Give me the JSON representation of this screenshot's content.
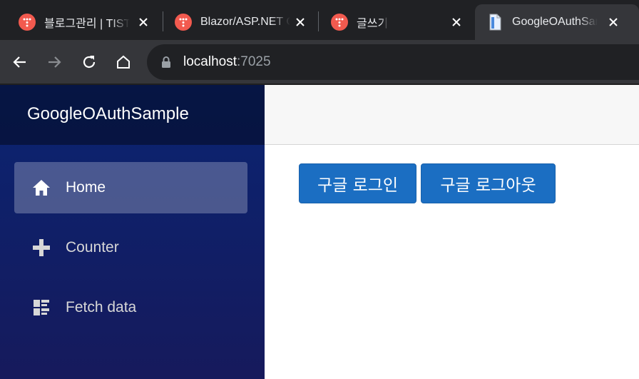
{
  "browser": {
    "tabs": [
      {
        "title": "블로그관리 | TISTORY",
        "favicon": "tistory-icon",
        "active": false
      },
      {
        "title": "Blazor/ASP.NET Core",
        "favicon": "tistory-icon",
        "active": false
      },
      {
        "title": "글쓰기",
        "favicon": "tistory-icon",
        "active": false
      },
      {
        "title": "GoogleOAuthSample",
        "favicon": "page-icon",
        "active": true
      }
    ],
    "address": {
      "host": "localhost",
      "port": ":7025"
    }
  },
  "app": {
    "brand": "GoogleOAuthSample",
    "nav": [
      {
        "label": "Home",
        "icon": "home-icon",
        "active": true
      },
      {
        "label": "Counter",
        "icon": "plus-icon",
        "active": false
      },
      {
        "label": "Fetch data",
        "icon": "list-icon",
        "active": false
      }
    ],
    "buttons": {
      "login": "구글 로그인",
      "logout": "구글 로그아웃"
    }
  },
  "colors": {
    "accent": "#1b6ec2",
    "favicon": "#f25a4f",
    "sidebar_top": "#0a2472",
    "sidebar_bottom": "#161a5c"
  }
}
